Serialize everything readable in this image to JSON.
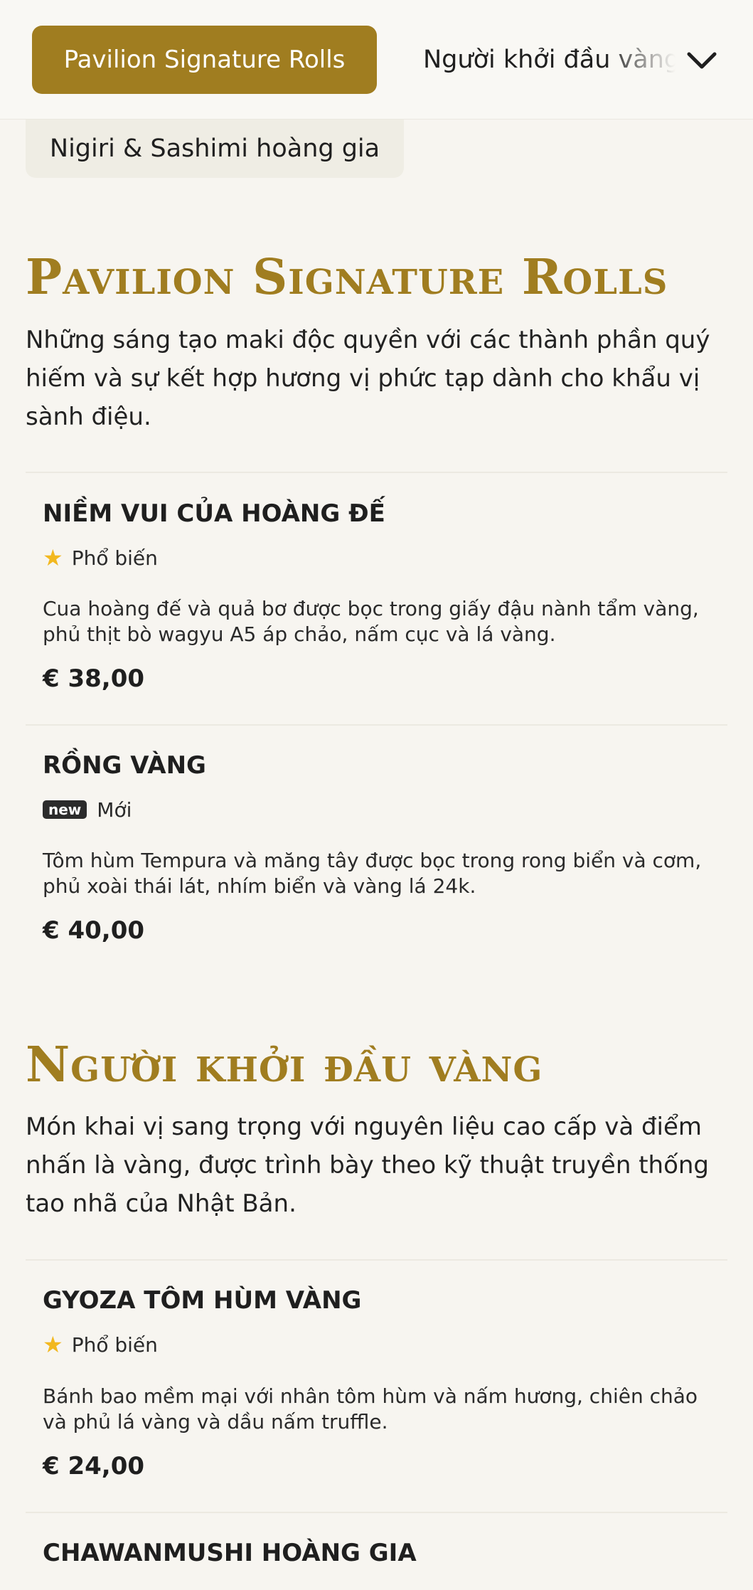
{
  "nav": {
    "active_tab": "Pavilion Signature Rolls",
    "next_tab": "Người khởi đầu vàng",
    "prev_tab": "Nigiri & Sashimi hoàng gia",
    "chevron_icon": "chevron-down-icon"
  },
  "colors": {
    "accent": "#a07d20",
    "background": "#f7f5f0",
    "star": "#f2b81f",
    "badge": "#2b2b2b"
  },
  "sections": [
    {
      "title": "Pavilion Signature Rolls",
      "description": "Những sáng tạo maki độc quyền với các thành phần quý hiếm và sự kết hợp hương vị phức tạp dành cho khẩu vị sành điệu.",
      "items": [
        {
          "name": "NIỀM VUI CỦA HOÀNG ĐẾ",
          "tag_icon": "star-icon",
          "tag": "Phổ biến",
          "description": "Cua hoàng đế và quả bơ được bọc trong giấy đậu nành tẩm vàng, phủ thịt bò wagyu A5 áp chảo, nấm cục và lá vàng.",
          "price": "€ 38,00"
        },
        {
          "name": "RỒNG VÀNG",
          "badge": "new",
          "tag": "Mới",
          "description": "Tôm hùm Tempura và măng tây được bọc trong rong biển và cơm, phủ xoài thái lát, nhím biển và vàng lá 24k.",
          "price": "€ 40,00"
        }
      ]
    },
    {
      "title": "Người khởi đầu vàng",
      "description": "Món khai vị sang trọng với nguyên liệu cao cấp và điểm nhấn là vàng, được trình bày theo kỹ thuật truyền thống tao nhã của Nhật Bản.",
      "items": [
        {
          "name": "GYOZA TÔM HÙM VÀNG",
          "tag_icon": "star-icon",
          "tag": "Phổ biến",
          "description": "Bánh bao mềm mại với nhân tôm hùm và nấm hương, chiên chảo và phủ lá vàng và dầu nấm truffle.",
          "price": "€ 24,00"
        },
        {
          "name": "CHAWANMUSHI HOÀNG GIA"
        }
      ]
    }
  ]
}
